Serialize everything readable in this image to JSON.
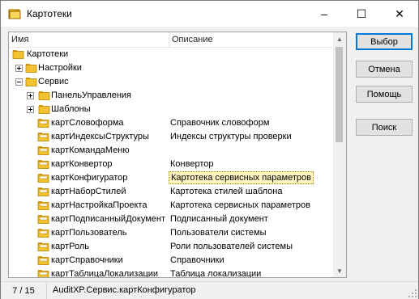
{
  "window": {
    "title": "Картотеки",
    "icon": "folder-stack-icon",
    "minimize": "–",
    "maximize": "☐",
    "close": "✕"
  },
  "tree": {
    "headers": {
      "name": "Имя",
      "description": "Описание"
    },
    "rows": [
      {
        "name": "Картотеки",
        "desc": "",
        "kind": "folder-open"
      },
      {
        "name": "Настройки",
        "desc": "",
        "kind": "folder"
      },
      {
        "name": "Сервис",
        "desc": "",
        "kind": "folder-open"
      },
      {
        "name": "ПанельУправления",
        "desc": "",
        "kind": "folder"
      },
      {
        "name": "Шаблоны",
        "desc": "",
        "kind": "folder"
      },
      {
        "name": "картСловоформа",
        "desc": "Справочник словоформ",
        "kind": "card"
      },
      {
        "name": "картИндексыСтруктуры",
        "desc": "Индексы структуры проверки",
        "kind": "card"
      },
      {
        "name": "картКомандаМеню",
        "desc": "",
        "kind": "card"
      },
      {
        "name": "картКонвертор",
        "desc": "Конвертор",
        "kind": "card"
      },
      {
        "name": "картКонфигуратор",
        "desc": "Картотека сервисных параметров",
        "kind": "card",
        "selected": true
      },
      {
        "name": "картНаборСтилей",
        "desc": "Картотека стилей шаблона",
        "kind": "card"
      },
      {
        "name": "картНастройкаПроекта",
        "desc": "Картотека сервисных параметров",
        "kind": "card"
      },
      {
        "name": "картПодписанныйДокумент",
        "desc": "Подписанный документ",
        "kind": "card"
      },
      {
        "name": "картПользователь",
        "desc": "Пользователи системы",
        "kind": "card"
      },
      {
        "name": "картРоль",
        "desc": "Роли пользователей системы",
        "kind": "card"
      },
      {
        "name": "картСправочники",
        "desc": "Справочники",
        "kind": "card"
      },
      {
        "name": "картТаблицаЛокализации",
        "desc": "Таблица локализации",
        "kind": "card"
      }
    ]
  },
  "buttons": {
    "select": "Выбор",
    "cancel": "Отмена",
    "help": "Помощь",
    "search": "Поиск"
  },
  "status": {
    "position": "7 / 15",
    "path": "AuditXP.Сервис.картКонфигуратор"
  },
  "colors": {
    "folder": "#f2c230",
    "selection": "#fff6bf",
    "default_button_border": "#0078d7"
  }
}
